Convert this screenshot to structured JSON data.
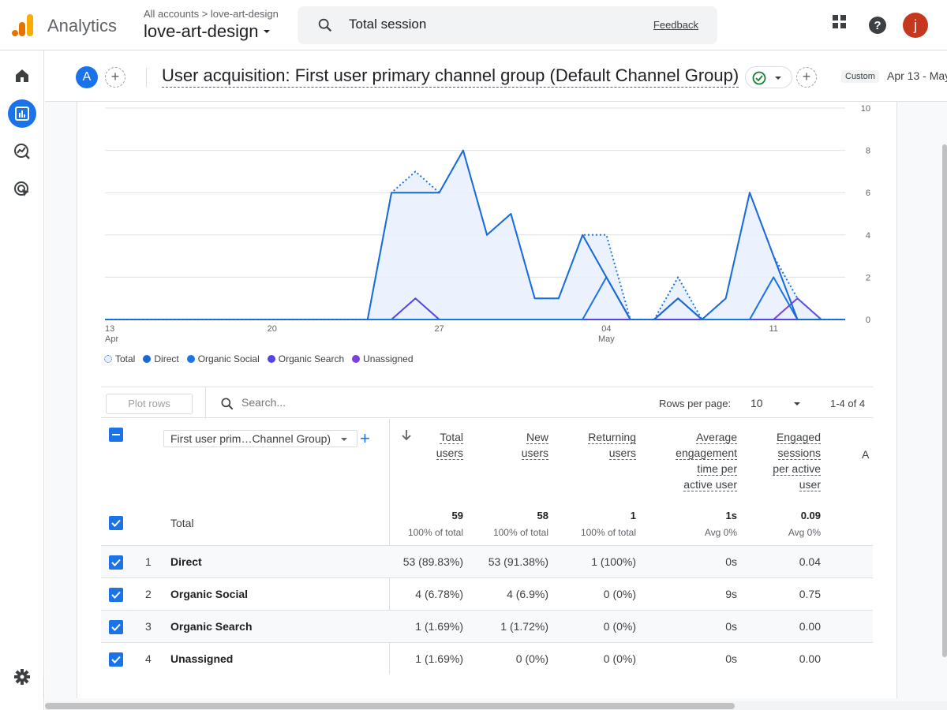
{
  "header": {
    "product": "Analytics",
    "breadcrumb": "All accounts > love-art-design",
    "account": "love-art-design",
    "search_value": "Total session",
    "feedback": "Feedback",
    "avatar_letter": "j"
  },
  "titlebar": {
    "comparison_badge": "A",
    "title": "User acquisition: First user primary channel group (Default Channel Group)",
    "custom_tag": "Custom",
    "date_range": "Apr 13 - May"
  },
  "chart_data": {
    "type": "area",
    "x": [
      "Apr 13",
      "Apr 14",
      "Apr 15",
      "Apr 16",
      "Apr 17",
      "Apr 18",
      "Apr 19",
      "Apr 20",
      "Apr 21",
      "Apr 22",
      "Apr 23",
      "Apr 24",
      "Apr 25",
      "Apr 26",
      "Apr 27",
      "Apr 28",
      "Apr 29",
      "Apr 30",
      "May 1",
      "May 2",
      "May 3",
      "May 4",
      "May 5",
      "May 6",
      "May 7",
      "May 8",
      "May 9",
      "May 10",
      "May 11",
      "May 12",
      "May 13",
      "May 14"
    ],
    "series": [
      {
        "name": "Total",
        "style": "dotted",
        "color": "#1a73e8",
        "values": [
          0,
          0,
          0,
          0,
          0,
          0,
          0,
          0,
          0,
          0,
          0,
          0,
          6,
          7,
          6,
          8,
          4,
          5,
          1,
          1,
          4,
          4,
          0,
          0,
          2,
          0,
          1,
          6,
          3,
          1,
          0,
          0
        ]
      },
      {
        "name": "Direct",
        "style": "solid",
        "color": "#1967d2",
        "values": [
          0,
          0,
          0,
          0,
          0,
          0,
          0,
          0,
          0,
          0,
          0,
          0,
          6,
          6,
          6,
          8,
          4,
          5,
          1,
          1,
          4,
          2,
          0,
          0,
          1,
          0,
          1,
          6,
          3,
          0,
          0,
          0
        ]
      },
      {
        "name": "Organic Social",
        "style": "solid",
        "color": "#1a73e8",
        "values": [
          0,
          0,
          0,
          0,
          0,
          0,
          0,
          0,
          0,
          0,
          0,
          0,
          0,
          0,
          0,
          0,
          0,
          0,
          0,
          0,
          0,
          2,
          0,
          0,
          1,
          0,
          0,
          0,
          2,
          0,
          0,
          0
        ]
      },
      {
        "name": "Organic Search",
        "style": "solid",
        "color": "#4f46e5",
        "values": [
          0,
          0,
          0,
          0,
          0,
          0,
          0,
          0,
          0,
          0,
          0,
          0,
          0,
          1,
          0,
          0,
          0,
          0,
          0,
          0,
          0,
          0,
          0,
          0,
          0,
          0,
          0,
          0,
          0,
          0,
          0,
          0
        ]
      },
      {
        "name": "Unassigned",
        "style": "solid",
        "color": "#7b3fe4",
        "values": [
          0,
          0,
          0,
          0,
          0,
          0,
          0,
          0,
          0,
          0,
          0,
          0,
          0,
          0,
          0,
          0,
          0,
          0,
          0,
          0,
          0,
          0,
          0,
          0,
          0,
          0,
          0,
          0,
          0,
          1,
          0,
          0
        ]
      }
    ],
    "x_ticks": [
      {
        "index": 0,
        "label": "13",
        "sub": "Apr"
      },
      {
        "index": 7,
        "label": "20",
        "sub": ""
      },
      {
        "index": 14,
        "label": "27",
        "sub": ""
      },
      {
        "index": 21,
        "label": "04",
        "sub": "May"
      },
      {
        "index": 28,
        "label": "11",
        "sub": ""
      }
    ],
    "y_ticks": [
      "0",
      "2",
      "4",
      "6",
      "8",
      "10"
    ],
    "ylim": [
      0,
      10
    ],
    "grid": true,
    "legend_position": "bottom-left"
  },
  "legend": [
    {
      "label": "Total",
      "color": "#1a73e8",
      "dotted": true
    },
    {
      "label": "Direct",
      "color": "#1967d2",
      "dotted": false
    },
    {
      "label": "Organic Social",
      "color": "#1a73e8",
      "dotted": false
    },
    {
      "label": "Organic Search",
      "color": "#4f46e5",
      "dotted": false
    },
    {
      "label": "Unassigned",
      "color": "#7b3fe4",
      "dotted": false
    }
  ],
  "table": {
    "plot_rows": "Plot rows",
    "search_placeholder": "Search...",
    "rows_per_page_label": "Rows per page:",
    "rows_per_page": "10",
    "pager": "1-4 of 4",
    "dimension": "First user prim…Channel Group)",
    "columns": [
      {
        "l1": "Total",
        "l2": "users"
      },
      {
        "l1": "New",
        "l2": "users"
      },
      {
        "l1": "Returning",
        "l2": "users"
      },
      {
        "l1": "Average",
        "l2": "engagement",
        "l3": "time per",
        "l4": "active user"
      },
      {
        "l1": "Engaged",
        "l2": "sessions",
        "l3": "per active",
        "l4": "user"
      },
      {
        "l1": "A"
      }
    ],
    "total": {
      "label": "Total",
      "values": [
        "59",
        "58",
        "1",
        "1s",
        "0.09"
      ],
      "subs": [
        "100% of total",
        "100% of total",
        "100% of total",
        "Avg 0%",
        "Avg 0%"
      ]
    },
    "rows": [
      {
        "num": "1",
        "name": "Direct",
        "values": [
          "53 (89.83%)",
          "53 (91.38%)",
          "1 (100%)",
          "0s",
          "0.04"
        ]
      },
      {
        "num": "2",
        "name": "Organic Social",
        "values": [
          "4 (6.78%)",
          "4 (6.9%)",
          "0 (0%)",
          "9s",
          "0.75"
        ]
      },
      {
        "num": "3",
        "name": "Organic Search",
        "values": [
          "1 (1.69%)",
          "1 (1.72%)",
          "0 (0%)",
          "0s",
          "0.00"
        ]
      },
      {
        "num": "4",
        "name": "Unassigned",
        "values": [
          "1 (1.69%)",
          "0 (0%)",
          "0 (0%)",
          "0s",
          "0.00"
        ]
      }
    ]
  }
}
